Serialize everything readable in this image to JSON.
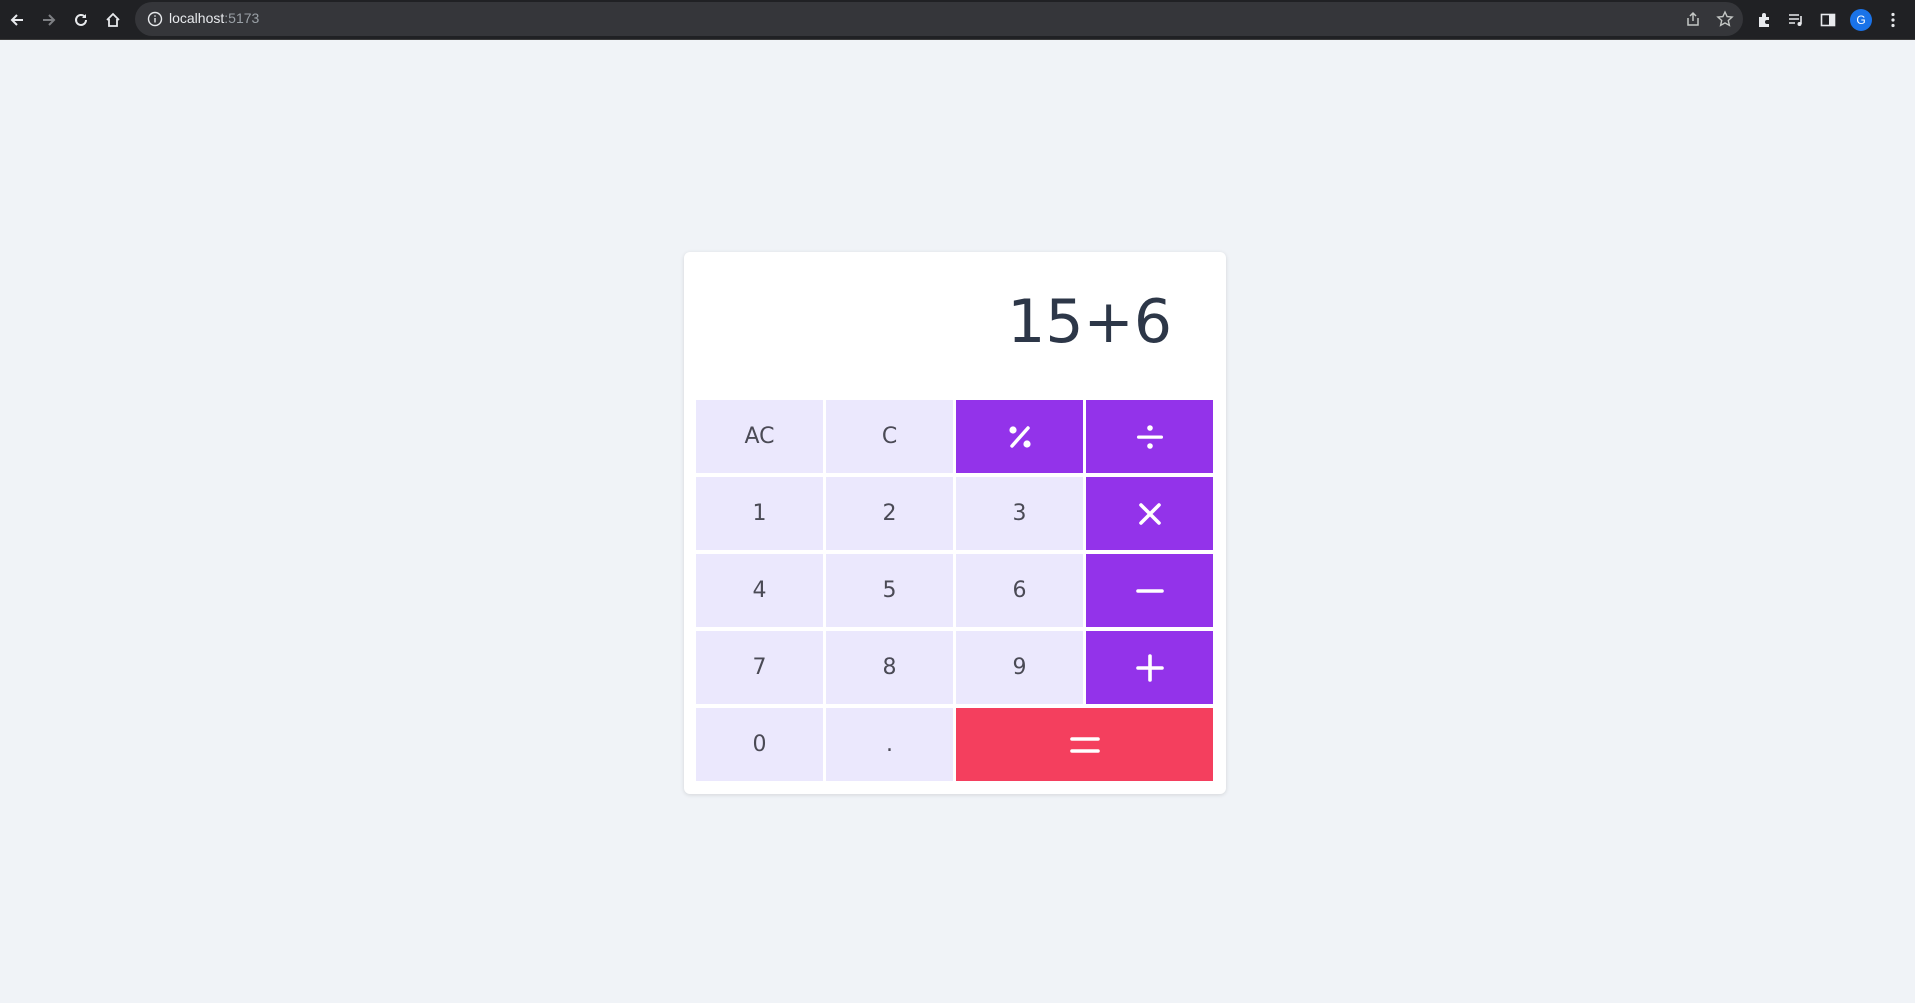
{
  "browser": {
    "url_host": "localhost",
    "url_port": ":5173",
    "profile_initial": "G"
  },
  "calculator": {
    "display": "15+6",
    "keys": {
      "ac": "AC",
      "c": "C",
      "one": "1",
      "two": "2",
      "three": "3",
      "four": "4",
      "five": "5",
      "six": "6",
      "seven": "7",
      "eight": "8",
      "nine": "9",
      "zero": "0",
      "dot": "."
    },
    "operator_icons": [
      "percent-icon",
      "divide-icon",
      "multiply-icon",
      "minus-icon",
      "plus-icon",
      "equals-icon"
    ],
    "colors": {
      "page_bg": "#f0f3f7",
      "number_key_bg": "#ebe8fd",
      "operator_key_bg": "#9333ea",
      "equals_key_bg": "#f43f5e",
      "display_text": "#2d3748"
    }
  }
}
